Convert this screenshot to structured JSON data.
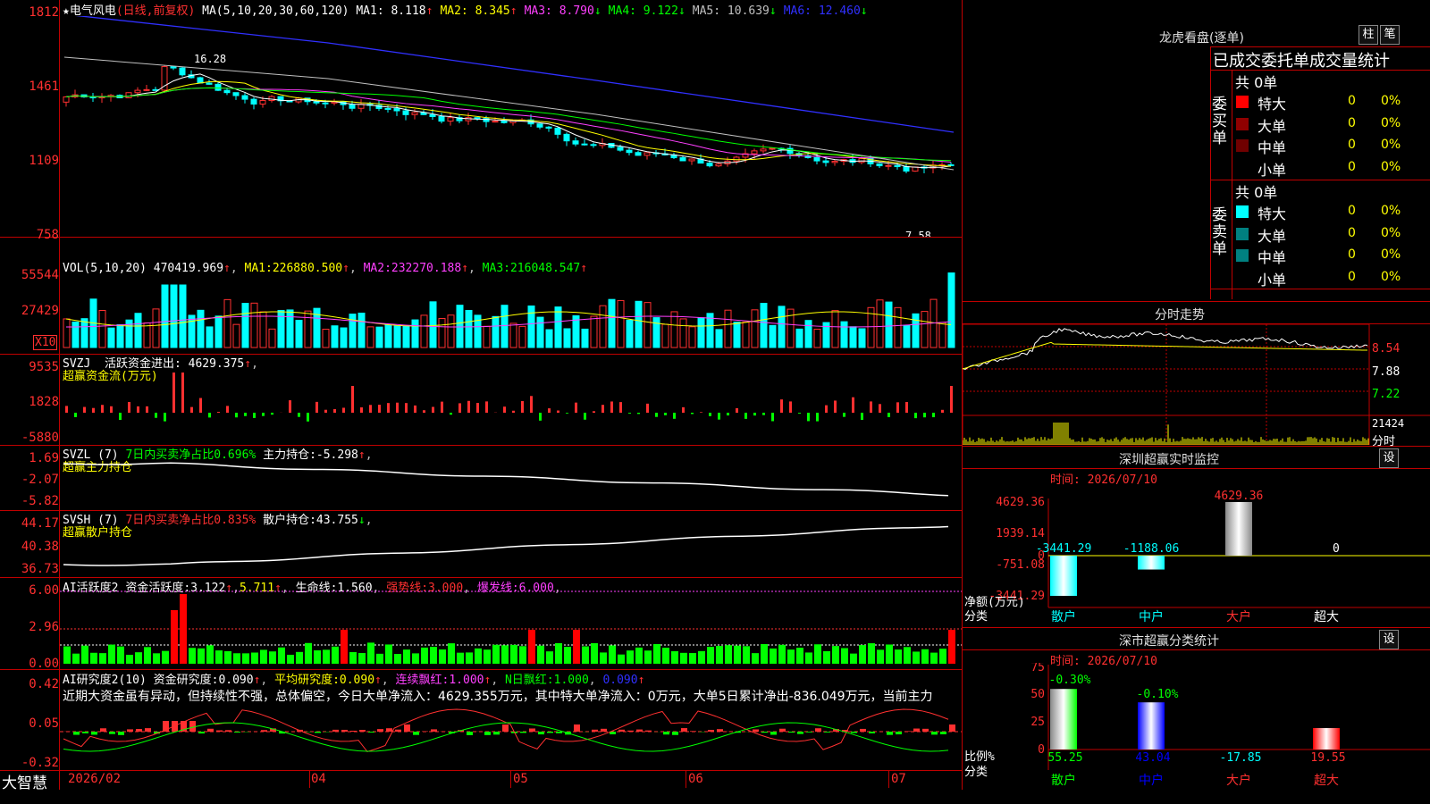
{
  "stock": {
    "name": "★电气风电",
    "mode": "(日线,前复权)"
  },
  "kline": {
    "ma_label": "MA(5,10,20,30,60,120)",
    "ma_values": [
      {
        "name": "MA1",
        "value": "8.118",
        "arrow": "↑",
        "color": "#ffffff"
      },
      {
        "name": "MA2",
        "value": "8.345",
        "arrow": "↑",
        "color": "#ffff00"
      },
      {
        "name": "MA3",
        "value": "8.790",
        "arrow": "↓",
        "color": "#ff40ff"
      },
      {
        "name": "MA4",
        "value": "9.122",
        "arrow": "↓",
        "color": "#00ff00"
      },
      {
        "name": "MA5",
        "value": "10.639",
        "arrow": "↓",
        "color": "#c0c0c0"
      },
      {
        "name": "MA6",
        "value": "12.460",
        "arrow": "↓",
        "color": "#3030ff"
      }
    ],
    "y_ticks": [
      "1812",
      "1461",
      "1109",
      "758"
    ],
    "high_label": "16.28",
    "low_label": "7.58"
  },
  "vol": {
    "title": "VOL(5,10,20)",
    "v": "470419.969",
    "ma1": "226880.500",
    "ma2": "232270.188",
    "ma3": "216048.547",
    "y_ticks": [
      "55544",
      "27429"
    ],
    "unit": "X10"
  },
  "svzj": {
    "title": "SVZJ",
    "l1": "活跃资金进出:",
    "v1": "4629.375",
    "l2": "超赢资金流(万元)",
    "y_ticks": [
      "9535",
      "1828",
      "-5880"
    ]
  },
  "svzl": {
    "title": "SVZL (7)",
    "l1": "7日内买卖净占比0.696%",
    "l2": "主力持仓:",
    "v2": "-5.298",
    "l3": "超赢主力持仓",
    "y_ticks": [
      "1.69",
      "-2.07",
      "-5.82"
    ]
  },
  "svsh": {
    "title": "SVSH (7)",
    "l1": "7日内买卖净占比0.835%",
    "l2": "散户持仓:",
    "v2": "43.755",
    "l3": "超赢散户持仓",
    "y_ticks": [
      "44.17",
      "40.38",
      "36.73"
    ]
  },
  "ai1": {
    "title": "AI活跃度2",
    "l1": "资金活跃度:",
    "v1": "3.122",
    "v2": "5.711",
    "l3": "生命线:",
    "v3": "1.560",
    "l4": "强势线:",
    "v4": "3.000",
    "l5": "爆发线:",
    "v5": "6.000",
    "y_ticks": [
      "6.00",
      "2.96",
      "0.00"
    ]
  },
  "ai2": {
    "title": "AI研究度2(10)",
    "l1": "资金研究度:",
    "v1": "0.090",
    "l2": "平均研究度:",
    "v2": "0.090",
    "l3": "连续飘红:",
    "v3": "1.000",
    "l4": "N日飘红:",
    "v4": "1.000",
    "v5": "0.090",
    "comment": "近期大资金虽有异动，但持续性不强，总体偏空，今日大单净流入：4629.355万元，其中特大单净流入：0万元，大单5日累计净出-836.049万元，当前主力",
    "y_ticks": [
      "0.42",
      "0.05",
      "-0.32"
    ]
  },
  "xaxis": {
    "brand": "大智慧",
    "labels": [
      "2026/02",
      "04",
      "05",
      "06",
      "07"
    ]
  },
  "longhu": {
    "title": "龙虎看盘(逐单)",
    "btn1": "柱",
    "btn2": "笔",
    "header": "已成交委托单成交量统计",
    "buy": {
      "side": "委买单",
      "total": "共 0单",
      "rows": [
        {
          "label": "特大",
          "count": "0",
          "pct": "0%",
          "color": "#ff0000"
        },
        {
          "label": "大单",
          "count": "0",
          "pct": "0%",
          "color": "#900000"
        },
        {
          "label": "中单",
          "count": "0",
          "pct": "0%",
          "color": "#700000"
        },
        {
          "label": "小单",
          "count": "0",
          "pct": "0%",
          "color": "#000000"
        }
      ]
    },
    "sell": {
      "side": "委卖单",
      "total": "共 0单",
      "rows": [
        {
          "label": "特大",
          "count": "0",
          "pct": "0%",
          "color": "#00ffff"
        },
        {
          "label": "大单",
          "count": "0",
          "pct": "0%",
          "color": "#008080"
        },
        {
          "label": "中单",
          "count": "0",
          "pct": "0%",
          "color": "#008080"
        },
        {
          "label": "小单",
          "count": "0",
          "pct": "0%",
          "color": "#000000"
        }
      ]
    }
  },
  "intraday": {
    "title": "分时走势",
    "y_ticks": [
      "8.54",
      "7.88",
      "7.22"
    ],
    "vol_label": "21424",
    "footer": "分时"
  },
  "monitor": {
    "title": "深圳超赢实时监控",
    "btn": "设",
    "time": "时间: 2026/07/10",
    "y_ticks": [
      "4629.36",
      "1939.14",
      "0",
      "-751.08",
      "-3441.29"
    ],
    "bar_values": [
      "-3441.29",
      "-1188.06",
      "4629.36",
      "0"
    ],
    "axis_label1": "净额(万元)",
    "axis_label2": "分类",
    "categories": [
      "散户",
      "中户",
      "大户",
      "超大"
    ]
  },
  "classify": {
    "title": "深市超赢分类统计",
    "btn": "设",
    "time": "时间: 2026/07/10",
    "y_ticks": [
      "75",
      "50",
      "25",
      "0"
    ],
    "top_labels": [
      "-0.30%",
      "-0.10%"
    ],
    "values": [
      "55.25",
      "43.04",
      "-17.85",
      "19.55"
    ],
    "axis_label1": "比例%",
    "axis_label2": "分类",
    "categories": [
      "散户",
      "中户",
      "大户",
      "超大"
    ]
  },
  "chart_data": [
    {
      "type": "bar",
      "title": "深圳超赢实时监控",
      "categories": [
        "散户",
        "中户",
        "大户",
        "超大"
      ],
      "values": [
        -3441.29,
        -1188.06,
        4629.36,
        0
      ],
      "ylabel": "净额(万元)",
      "ylim": [
        -3441.29,
        4629.36
      ]
    },
    {
      "type": "bar",
      "title": "深市超赢分类统计",
      "categories": [
        "散户",
        "中户",
        "大户",
        "超大"
      ],
      "values": [
        55.25,
        43.04,
        -17.85,
        19.55
      ],
      "ylabel": "比例%",
      "ylim": [
        0,
        75
      ]
    }
  ]
}
